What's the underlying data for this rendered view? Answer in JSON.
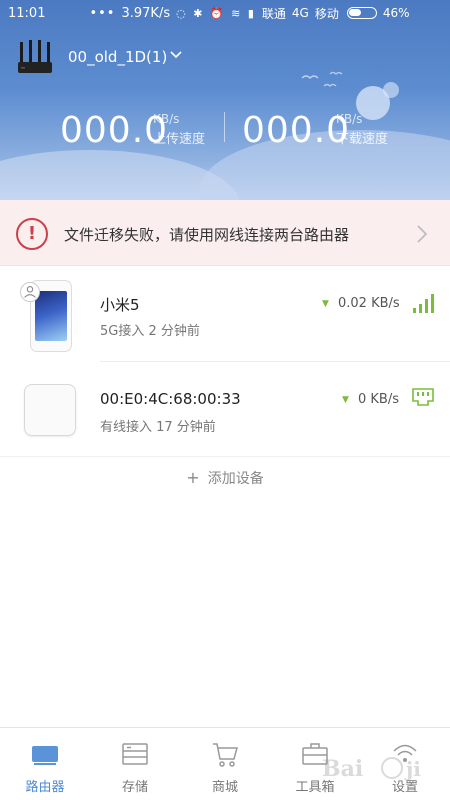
{
  "status_bar": {
    "time": "11:01",
    "dots": "•••",
    "speed": "3.97K/s",
    "icons": "◌ ✱ ⏰ ≋ ▮",
    "carrier1": "联通",
    "network": "4G",
    "carrier2": "移动",
    "battery_pct": "46%",
    "battery_level": 0.46
  },
  "header": {
    "router_name": "00_old_1D(1)",
    "upload": {
      "value": "000.0",
      "unit": "KB/s",
      "label": "上传速度"
    },
    "download": {
      "value": "000.0",
      "unit": "KB/s",
      "label": "下载速度"
    }
  },
  "alert": {
    "icon": "!",
    "text": "文件迁移失败，请使用网线连接两台路由器"
  },
  "devices": [
    {
      "name": "小米5",
      "meta": "5G接入   2 分钟前",
      "rate": "0.02 KB/s",
      "rate_arrow": "▼",
      "signal_icon": "wifi-bars-icon"
    },
    {
      "name": "00:E0:4C:68:00:33",
      "meta": "有线接入   17 分钟前",
      "rate": "0 KB/s",
      "rate_arrow": "▼",
      "signal_icon": "lan-port-icon"
    }
  ],
  "add_device": {
    "plus": "+",
    "label": "添加设备"
  },
  "nav": {
    "items": [
      {
        "label": "路由器",
        "icon": "router-icon",
        "active": true
      },
      {
        "label": "存储",
        "icon": "storage-icon",
        "active": false
      },
      {
        "label": "商城",
        "icon": "cart-icon",
        "active": false
      },
      {
        "label": "工具箱",
        "icon": "toolbox-icon",
        "active": false
      },
      {
        "label": "设置",
        "icon": "settings-icon",
        "active": false
      }
    ]
  },
  "colors": {
    "header_top": "#4c7ac2",
    "alert_bg": "#fbeeee",
    "alert_accent": "#c9414a",
    "accent_green": "#7bbd3b",
    "nav_active": "#4f8ad6"
  }
}
